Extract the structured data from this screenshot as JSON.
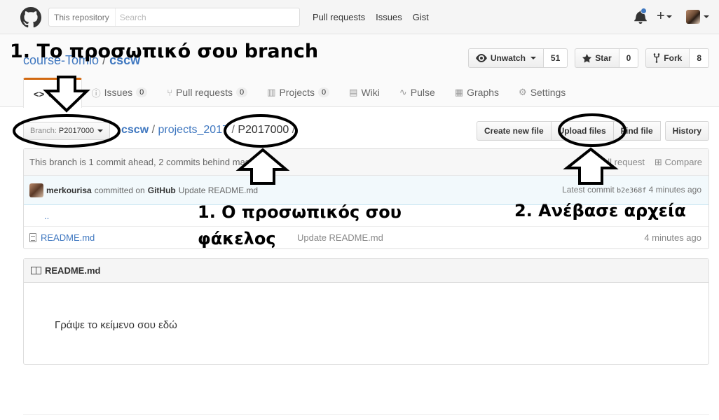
{
  "header": {
    "search_scope": "This repository",
    "search_placeholder": "Search",
    "nav": [
      "Pull requests",
      "Issues",
      "Gist"
    ],
    "plus_symbol": "+"
  },
  "repo": {
    "owner": "course-Tomio",
    "separator": "/",
    "name": "cscw",
    "actions": {
      "watch_label": "Unwatch",
      "watch_count": "51",
      "star_label": "Star",
      "star_count": "0",
      "fork_label": "Fork",
      "fork_count": "8"
    },
    "tabs": [
      {
        "label": "Code",
        "icon": "code-icon",
        "count": null
      },
      {
        "label": "Issues",
        "icon": "issue-icon",
        "count": "0"
      },
      {
        "label": "Pull requests",
        "icon": "pull-request-icon",
        "count": "0"
      },
      {
        "label": "Projects",
        "icon": "project-icon",
        "count": "0"
      },
      {
        "label": "Wiki",
        "icon": "book-icon",
        "count": null
      },
      {
        "label": "Pulse",
        "icon": "pulse-icon",
        "count": null
      },
      {
        "label": "Graphs",
        "icon": "graph-icon",
        "count": null
      },
      {
        "label": "Settings",
        "icon": "gear-icon",
        "count": null
      }
    ]
  },
  "file_nav": {
    "branch_label": "Branch:",
    "branch_name": "P2017000",
    "path": [
      "cscw",
      "projects_2017",
      "P2017000"
    ],
    "buttons": [
      "Create new file",
      "Upload files",
      "Find file",
      "History"
    ]
  },
  "branch_status": {
    "text": "This branch is 1 commit ahead, 2 commits behind master.",
    "pull_request": "Pull request",
    "compare": "Compare"
  },
  "commit": {
    "author": "merkourisa",
    "committed_on": "committed on",
    "platform": "GitHub",
    "message": "Update README.md",
    "latest_label": "Latest commit",
    "sha": "b2e368f",
    "age": "4 minutes ago"
  },
  "files": {
    "parent": "..",
    "rows": [
      {
        "name": "README.md",
        "message": "Update README.md",
        "age": "4 minutes ago"
      }
    ]
  },
  "readme": {
    "title": "README.md",
    "body": "Γράψε το κείμενο σου εδώ"
  },
  "annotations": {
    "branch": "1. Το προσωπικό σου branch",
    "folder": "1. Ο προσωπικός σου φάκελος",
    "upload": "2. Ανέβασε αρχεία"
  }
}
